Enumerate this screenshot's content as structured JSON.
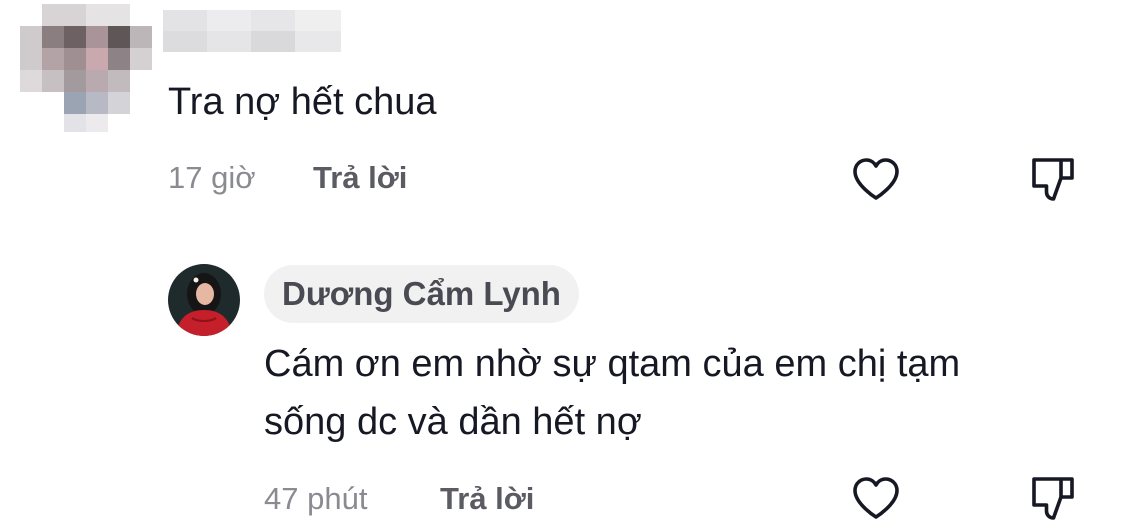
{
  "comments": [
    {
      "text": "Tra nợ hết chua",
      "time": "17 giờ",
      "reply_label": "Trả lời",
      "icons": {
        "like": "heart-outline-icon",
        "dislike": "thumbs-down-icon"
      }
    }
  ],
  "reply": {
    "author": "Dương Cẩm Lynh",
    "text_line1": "Cám ơn em nhờ sự qtam của em chị tạm",
    "text_line2": "sống dc và dần hết nợ",
    "time": "47 phút",
    "reply_label": "Trả lời",
    "icons": {
      "like": "heart-outline-icon",
      "dislike": "thumbs-down-icon"
    }
  },
  "colors": {
    "text": "#161823",
    "meta": "#8a8b91",
    "reply_button": "#5b5c63",
    "pill_bg": "#f1f1f2"
  }
}
